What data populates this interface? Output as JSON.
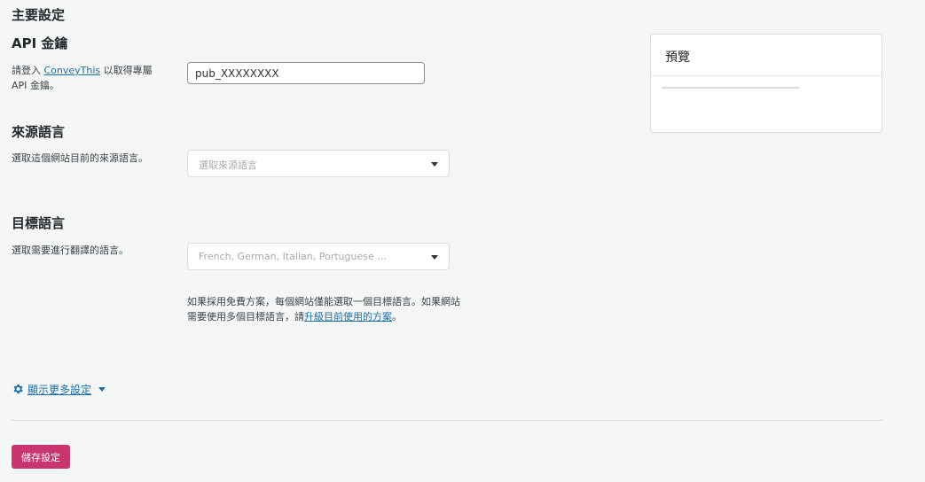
{
  "page_title": "主要設定",
  "api_section": {
    "title": "API 金鑰",
    "desc_before": "請登入 ",
    "desc_link": "ConveyThis",
    "desc_after": " 以取得專屬API 金鑰。",
    "input_value": "pub_XXXXXXXX"
  },
  "source_section": {
    "title": "來源語言",
    "desc": "選取這個網站目前的來源語言。",
    "placeholder": "選取來源語言"
  },
  "target_section": {
    "title": "目標語言",
    "desc": "選取需要進行翻譯的語言。",
    "placeholder": "French, German, Italian, Portuguese ...",
    "note_before": "如果採用免費方案，每個網站僅能選取一個目標語言。如果網站需要使用多個目標語言，請",
    "note_link": "升級目前使用的方案",
    "note_after": "。"
  },
  "more_settings": {
    "label": "顯示更多設定",
    "icon": "gear-icon"
  },
  "save_button": "儲存設定",
  "preview": {
    "title": "預覽"
  },
  "colors": {
    "accent": "#c9356e",
    "link": "#1e6fa3",
    "background": "#f5f6f6"
  }
}
